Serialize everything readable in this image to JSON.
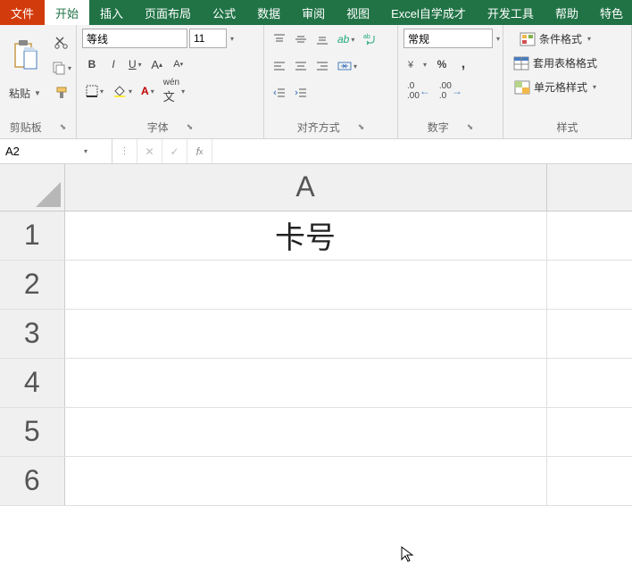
{
  "tabs": {
    "file": "文件",
    "home": "开始",
    "insert": "插入",
    "layout": "页面布局",
    "formulas": "公式",
    "data": "数据",
    "review": "审阅",
    "view": "视图",
    "selfstudy": "Excel自学成才",
    "developer": "开发工具",
    "help": "帮助",
    "special": "特色"
  },
  "ribbon": {
    "clipboard": {
      "label": "剪贴板",
      "paste": "粘贴"
    },
    "font": {
      "label": "字体",
      "name": "等线",
      "size": "11"
    },
    "align": {
      "label": "对齐方式"
    },
    "number": {
      "label": "数字",
      "format": "常规"
    },
    "styles": {
      "label": "样式",
      "cond": "条件格式",
      "tablefmt": "套用表格格式",
      "cellstyle": "单元格样式"
    }
  },
  "namebox": "A2",
  "formula": "",
  "grid": {
    "colA": "A",
    "rows": [
      "1",
      "2",
      "3",
      "4",
      "5",
      "6"
    ],
    "A1": "卡号"
  }
}
